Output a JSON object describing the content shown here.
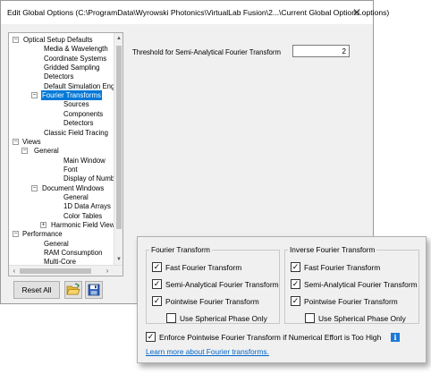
{
  "window": {
    "title": "Edit Global Options (C:\\ProgramData\\Wyrowski Photonics\\VirtualLab Fusion\\2...\\Current Global Options.options)",
    "close_glyph": "✕"
  },
  "tree": {
    "items": [
      {
        "label": "Optical Setup Defaults",
        "expander": "−"
      },
      {
        "label": "Media & Wavelength"
      },
      {
        "label": "Coordinate Systems"
      },
      {
        "label": "Gridded Sampling"
      },
      {
        "label": "Detectors"
      },
      {
        "label": "Default Simulation Engir"
      },
      {
        "label": "Fourier Transforms",
        "expander": "−",
        "selected": true
      },
      {
        "label": "Sources"
      },
      {
        "label": "Components"
      },
      {
        "label": "Detectors"
      },
      {
        "label": "Classic Field Tracing"
      },
      {
        "label": "Views",
        "expander": "−"
      },
      {
        "label": "General",
        "expander": "−"
      },
      {
        "label": "Main Window"
      },
      {
        "label": "Font"
      },
      {
        "label": "Display of Numbers"
      },
      {
        "label": "Document Windows",
        "expander": "−"
      },
      {
        "label": "General"
      },
      {
        "label": "1D Data Arrays"
      },
      {
        "label": "Color Tables"
      },
      {
        "label": "Harmonic Field View",
        "expander": "+"
      },
      {
        "label": "Performance",
        "expander": "−"
      },
      {
        "label": "General"
      },
      {
        "label": "RAM Consumption"
      },
      {
        "label": "Multi-Core"
      }
    ],
    "scroll_up": "▲",
    "scroll_down": "▼",
    "scroll_left": "‹",
    "scroll_right": "›"
  },
  "buttons": {
    "reset_all": "Reset All",
    "open_icon": "folder-open-icon",
    "save_icon": "floppy-disk-icon"
  },
  "main": {
    "threshold_label": "Threshold for Semi-Analytical Fourier Transform",
    "threshold_value": "2"
  },
  "overlay": {
    "fourier": {
      "legend": "Fourier Transform",
      "options": [
        {
          "label": "Fast Fourier Transform",
          "checked": true
        },
        {
          "label": "Semi-Analytical Fourier Transform",
          "checked": true
        },
        {
          "label": "Pointwise Fourier Transform",
          "checked": true
        },
        {
          "label": "Use Spherical Phase Only",
          "checked": false
        }
      ]
    },
    "inverse": {
      "legend": "Inverse Fourier Transform",
      "options": [
        {
          "label": "Fast Fourier Transform",
          "checked": true
        },
        {
          "label": "Semi-Analytical Fourier Transform",
          "checked": true
        },
        {
          "label": "Pointwise Fourier Transform",
          "checked": true
        },
        {
          "label": "Use Spherical Phase Only",
          "checked": false
        }
      ]
    },
    "enforce_label": "Enforce Pointwise Fourier Transform if Numerical Effort is Too High",
    "enforce_checked": true,
    "info_glyph": "i",
    "learn_more": "Learn more about Fourier transforms."
  },
  "colors": {
    "selection": "#0078d7",
    "link": "#0066cc",
    "info": "#1e78d7"
  }
}
